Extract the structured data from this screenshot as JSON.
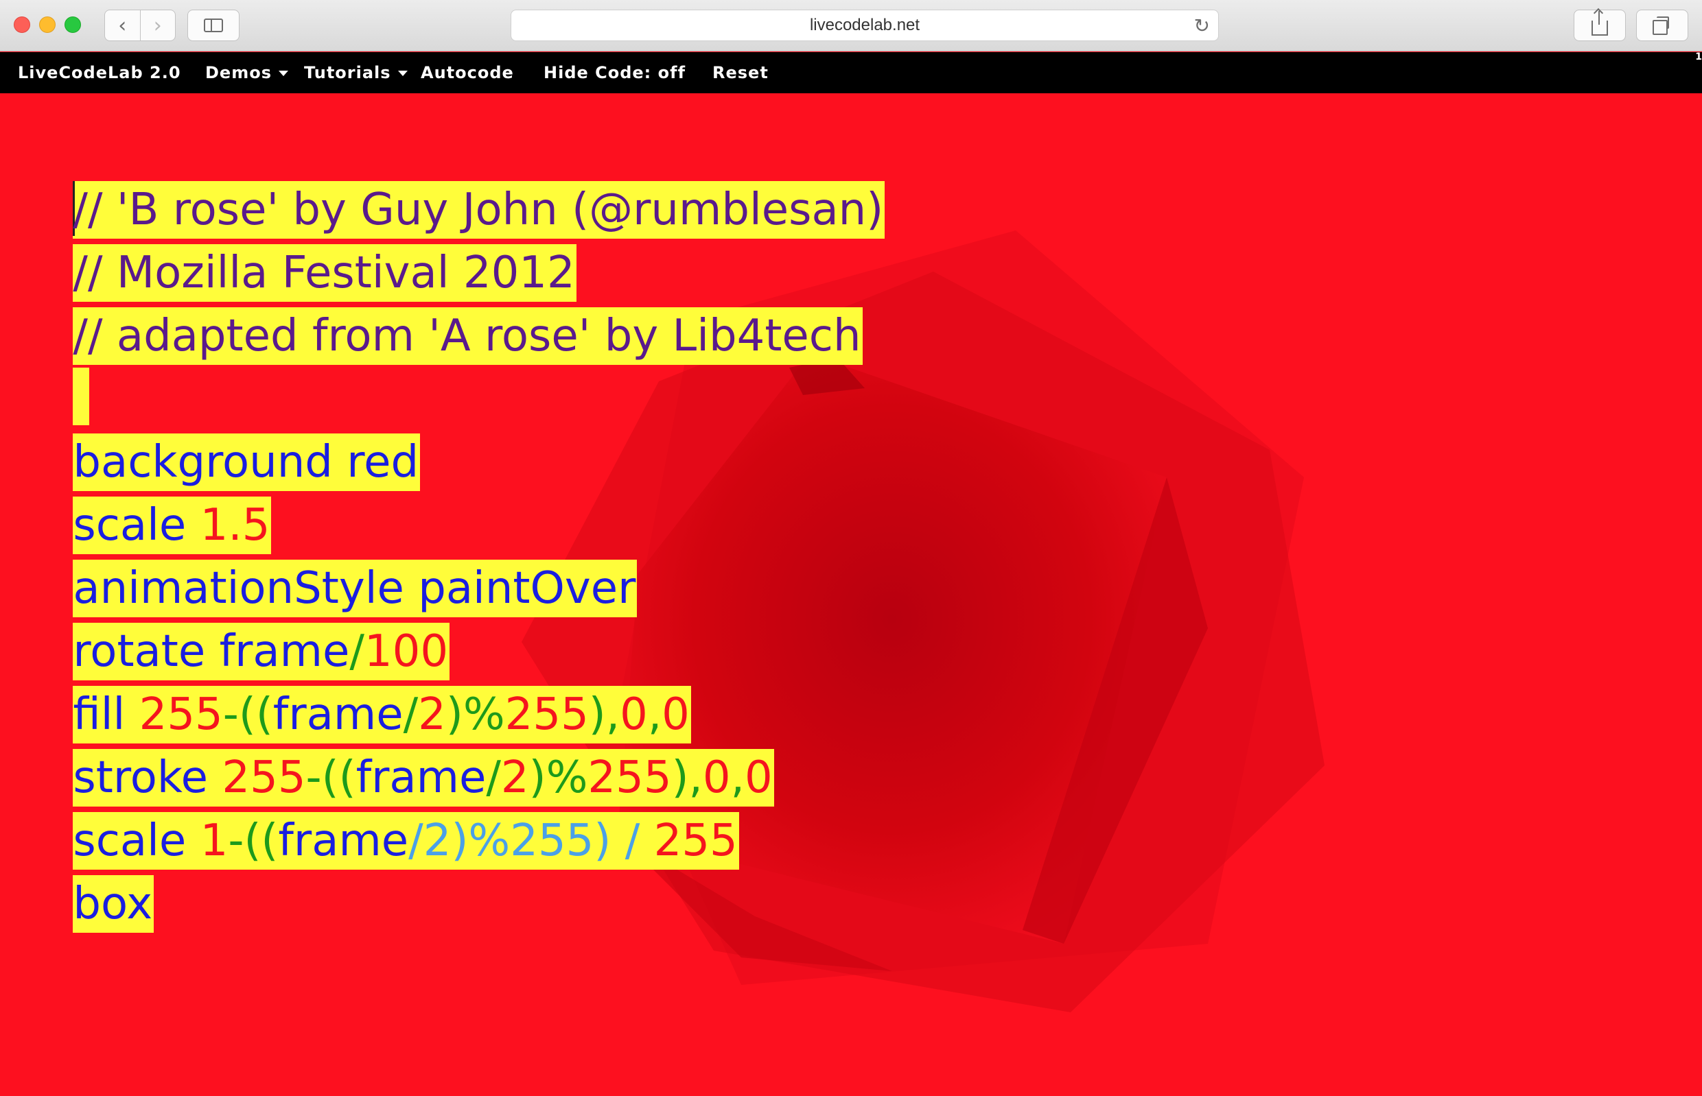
{
  "browser": {
    "url": "livecodelab.net",
    "back_icon": "‹",
    "forward_icon": "›",
    "reload_icon": "↻"
  },
  "menubar": {
    "brand": "LiveCodeLab 2.0",
    "demos": "Demos",
    "tutorials": "Tutorials",
    "autocode": "Autocode",
    "hide_code": "Hide Code: off",
    "reset": "Reset",
    "scroll_marker": "1"
  },
  "colors": {
    "background": "#fd101f",
    "highlight": "#fffd3a",
    "comment": "#5a1a8c",
    "keyword": "#1a1ee0",
    "number": "#f5141e",
    "operator": "#1d9a1b",
    "dim": "#4aa0e8"
  },
  "code": {
    "line1": "// 'B rose' by Guy John (@rumblesan)",
    "line2": "// Mozilla Festival 2012",
    "line3": "// adapted from 'A rose' by Lib4tech",
    "l5_kw": "background red",
    "l6_kw": "scale ",
    "l6_num": "1.5",
    "l7_kw": "animationStyle paintOver",
    "l8_kw": "rotate frame",
    "l8_op": "/",
    "l8_num": "100",
    "l9_kw": "fill ",
    "l9_num1": "255",
    "l9_op1": "-((",
    "l9_kw2": "frame",
    "l9_op2": "/",
    "l9_num2": "2",
    "l9_op3": ")%",
    "l9_num3": "255",
    "l9_op4": "),",
    "l9_num4": "0",
    "l9_op5": ",",
    "l9_num5": "0",
    "l10_kw": "stroke ",
    "l10_num1": "255",
    "l10_op1": "-((",
    "l10_kw2": "frame",
    "l10_op2": "/",
    "l10_num2": "2",
    "l10_op3": ")%",
    "l10_num3": "255",
    "l10_op4": "),",
    "l10_num4": "0",
    "l10_op5": ",",
    "l10_num5": "0",
    "l11_kw": "scale ",
    "l11_num1": "1",
    "l11_op1": "-((",
    "l11_kw2": "frame",
    "l11_dim": "/2)%255) / ",
    "l11_num2": "255",
    "l12_kw": "box"
  }
}
